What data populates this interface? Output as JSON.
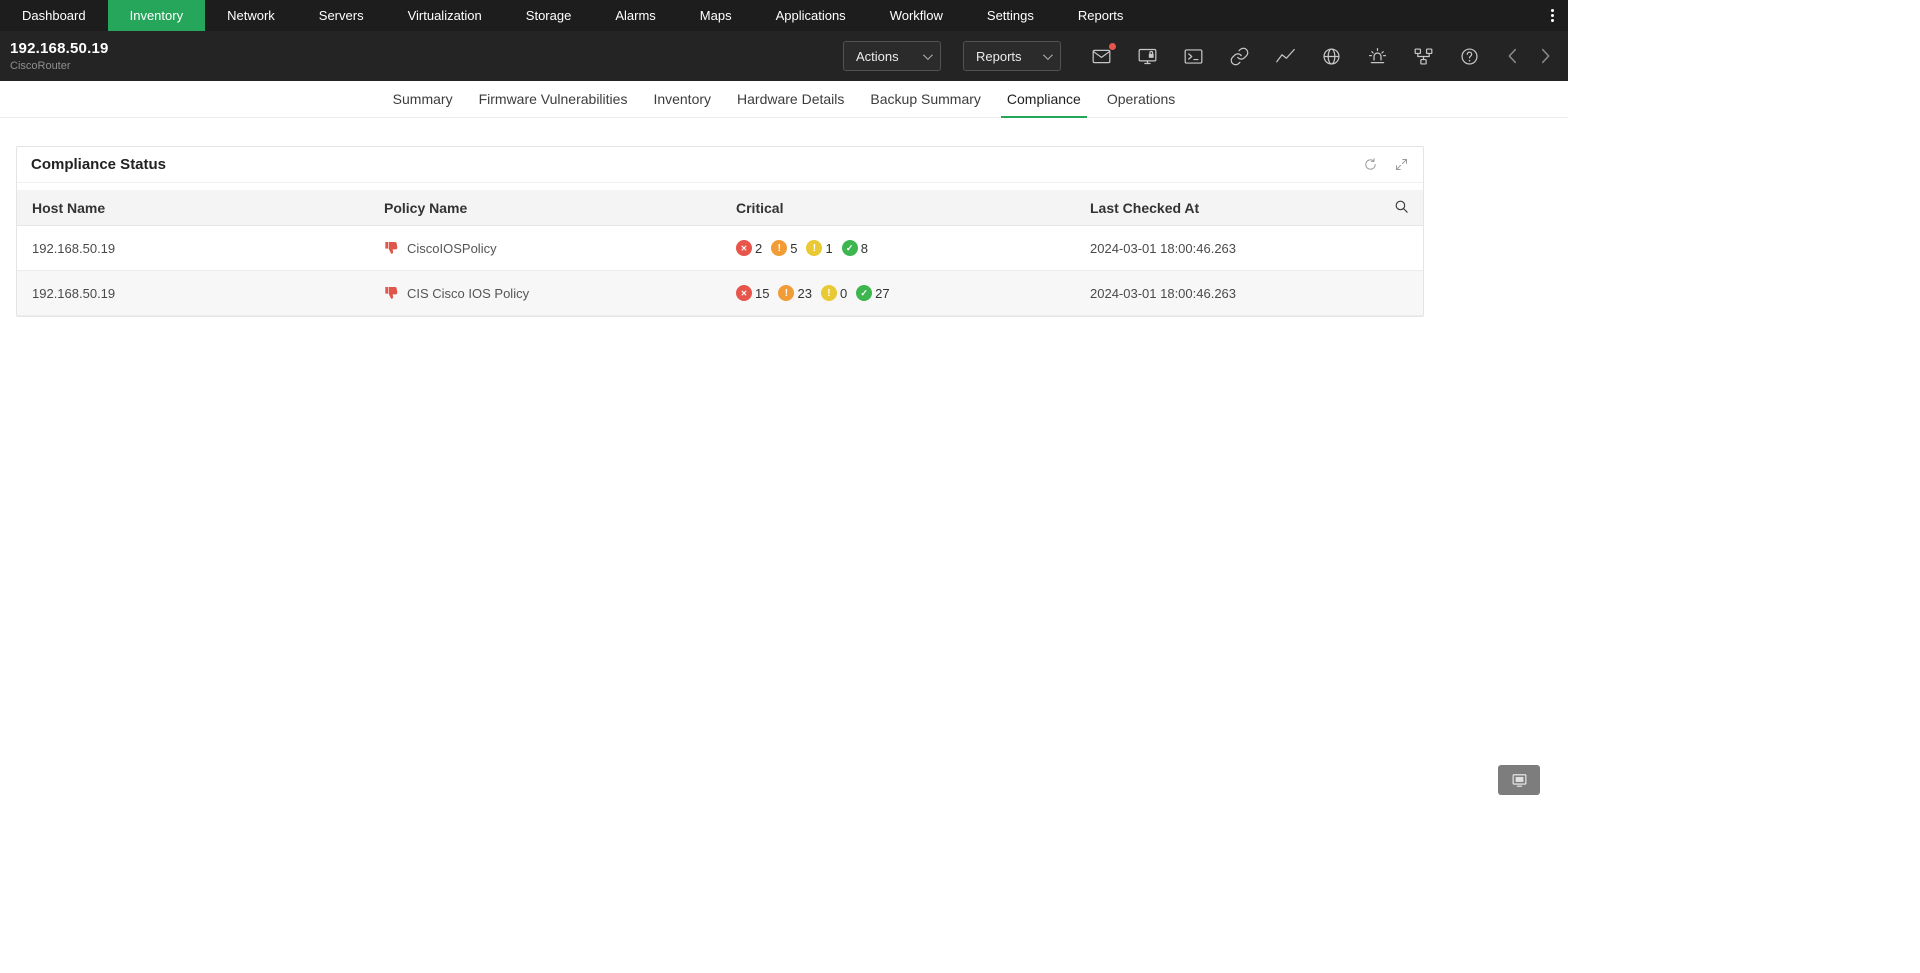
{
  "colors": {
    "accent_green": "#26a65b",
    "nav_bg": "#1d1d1d",
    "device_bar_bg": "#242424",
    "severity_critical": "#e8564b",
    "severity_major": "#f29c38",
    "severity_minor": "#e9c934",
    "severity_compliant": "#3eb650"
  },
  "nav": {
    "items": [
      "Dashboard",
      "Inventory",
      "Network",
      "Servers",
      "Virtualization",
      "Storage",
      "Alarms",
      "Maps",
      "Applications",
      "Workflow",
      "Settings",
      "Reports"
    ],
    "active": "Inventory"
  },
  "device": {
    "title": "192.168.50.19",
    "subtitle": "CiscoRouter",
    "actions_label": "Actions",
    "reports_label": "Reports",
    "toolbar_icons": [
      "mail-icon",
      "remote-access-icon",
      "terminal-icon",
      "link-icon",
      "performance-icon",
      "globe-icon",
      "alert-icon",
      "topology-icon",
      "help-icon",
      "prev-device-icon",
      "next-device-icon"
    ]
  },
  "tabs": {
    "items": [
      "Summary",
      "Firmware Vulnerabilities",
      "Inventory",
      "Hardware Details",
      "Backup Summary",
      "Compliance",
      "Operations"
    ],
    "active": "Compliance"
  },
  "compliance": {
    "title": "Compliance Status",
    "card_icons": [
      "refresh-icon",
      "resize-icon",
      "search-icon"
    ],
    "columns": [
      "Host Name",
      "Policy Name",
      "Critical",
      "Last Checked At"
    ],
    "rows": [
      {
        "host": "192.168.50.19",
        "policy": "CiscoIOSPolicy",
        "counts": [
          {
            "severity": "critical",
            "value": 2
          },
          {
            "severity": "major",
            "value": 5
          },
          {
            "severity": "minor",
            "value": 1
          },
          {
            "severity": "compliant",
            "value": 8
          }
        ],
        "last_checked": "2024-03-01 18:00:46.263"
      },
      {
        "host": "192.168.50.19",
        "policy": "CIS Cisco IOS Policy",
        "counts": [
          {
            "severity": "critical",
            "value": 15
          },
          {
            "severity": "major",
            "value": 23
          },
          {
            "severity": "minor",
            "value": 0
          },
          {
            "severity": "compliant",
            "value": 27
          }
        ],
        "last_checked": "2024-03-01 18:00:46.263"
      }
    ]
  }
}
